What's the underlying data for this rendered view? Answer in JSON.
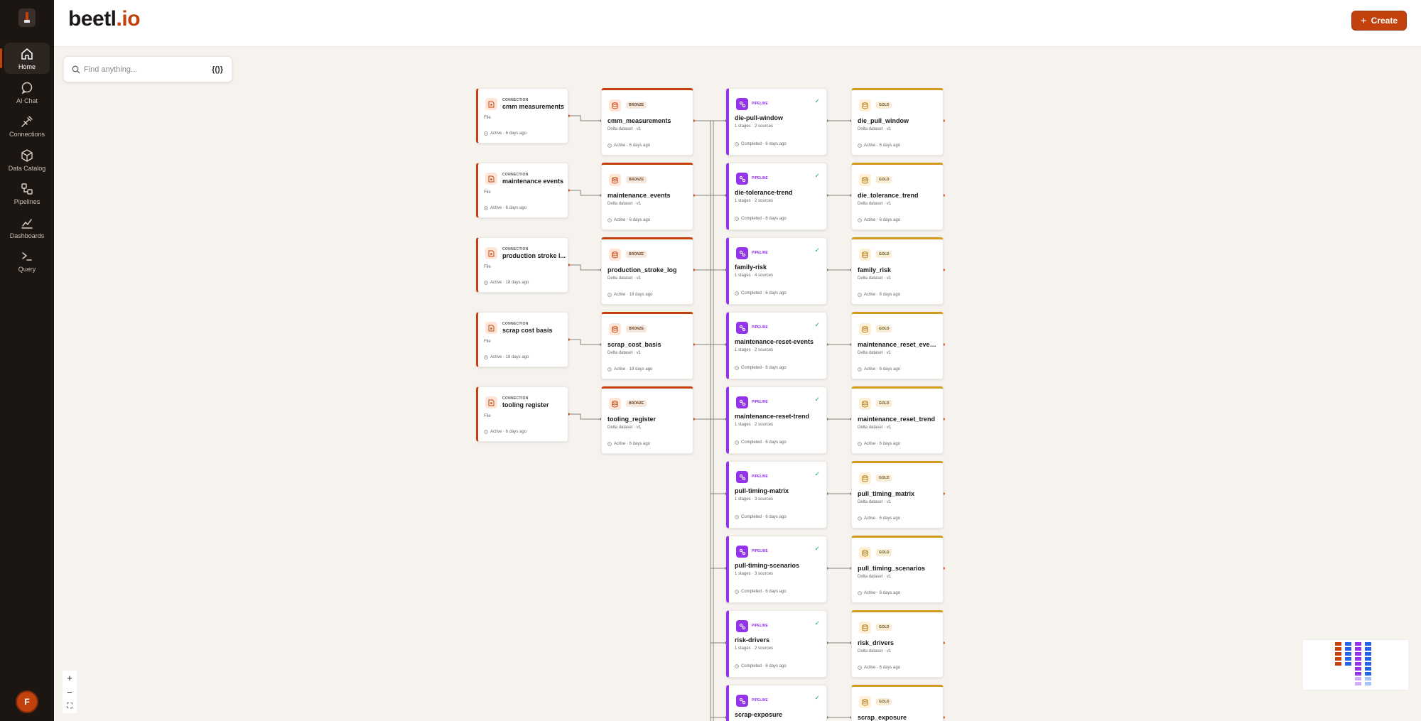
{
  "sidebar": {
    "items": [
      {
        "label": "Home",
        "icon": "home-icon",
        "active": true
      },
      {
        "label": "AI Chat",
        "icon": "chat-icon"
      },
      {
        "label": "Connections",
        "icon": "plug-icon"
      },
      {
        "label": "Data Catalog",
        "icon": "cube-icon"
      },
      {
        "label": "Pipelines",
        "icon": "pipeline-icon"
      },
      {
        "label": "Dashboards",
        "icon": "chart-icon"
      },
      {
        "label": "Query",
        "icon": "terminal-icon"
      }
    ],
    "avatar": "F"
  },
  "header": {
    "brand_main": "beetl",
    "brand_dot": ".io",
    "create_label": "Create"
  },
  "search": {
    "placeholder": "Find anything...",
    "ai_toggle": "{()}"
  },
  "colors": {
    "accent": "#c2410c",
    "pipeline": "#9333ea",
    "gold": "#d39b1e",
    "check": "#16a34a"
  },
  "graph": {
    "connections": [
      {
        "type": "CONNECTION",
        "title": "cmm measurements",
        "sub": "File",
        "status": "Active · 6 days ago"
      },
      {
        "type": "CONNECTION",
        "title": "maintenance events",
        "sub": "File",
        "status": "Active · 6 days ago"
      },
      {
        "type": "CONNECTION",
        "title": "production stroke l...",
        "sub": "File",
        "status": "Active · 18 days ago"
      },
      {
        "type": "CONNECTION",
        "title": "scrap cost basis",
        "sub": "File",
        "status": "Active · 18 days ago"
      },
      {
        "type": "CONNECTION",
        "title": "tooling register",
        "sub": "File",
        "status": "Active · 6 days ago"
      }
    ],
    "bronze": [
      {
        "badge": "BRONZE",
        "title": "cmm_measurements",
        "sub": "Delta dataset · v1",
        "status": "Active · 6 days ago"
      },
      {
        "badge": "BRONZE",
        "title": "maintenance_events",
        "sub": "Delta dataset · v1",
        "status": "Active · 6 days ago"
      },
      {
        "badge": "BRONZE",
        "title": "production_stroke_log",
        "sub": "Delta dataset · v1",
        "status": "Active · 18 days ago"
      },
      {
        "badge": "BRONZE",
        "title": "scrap_cost_basis",
        "sub": "Delta dataset · v1",
        "status": "Active · 18 days ago"
      },
      {
        "badge": "BRONZE",
        "title": "tooling_register",
        "sub": "Delta dataset · v1",
        "status": "Active · 6 days ago"
      }
    ],
    "pipelines": [
      {
        "badge": "PIPELINE",
        "title": "die-pull-window",
        "sub": "1 stages · 2 sources",
        "status": "Completed · 6 days ago"
      },
      {
        "badge": "PIPELINE",
        "title": "die-tolerance-trend",
        "sub": "1 stages · 2 sources",
        "status": "Completed · 6 days ago"
      },
      {
        "badge": "PIPELINE",
        "title": "family-risk",
        "sub": "1 stages · 4 sources",
        "status": "Completed · 6 days ago"
      },
      {
        "badge": "PIPELINE",
        "title": "maintenance-reset-events",
        "sub": "1 stages · 2 sources",
        "status": "Completed · 6 days ago"
      },
      {
        "badge": "PIPELINE",
        "title": "maintenance-reset-trend",
        "sub": "1 stages · 2 sources",
        "status": "Completed · 6 days ago"
      },
      {
        "badge": "PIPELINE",
        "title": "pull-timing-matrix",
        "sub": "1 stages · 3 sources",
        "status": "Completed · 6 days ago"
      },
      {
        "badge": "PIPELINE",
        "title": "pull-timing-scenarios",
        "sub": "1 stages · 3 sources",
        "status": "Completed · 6 days ago"
      },
      {
        "badge": "PIPELINE",
        "title": "risk-drivers",
        "sub": "1 stages · 2 sources",
        "status": "Completed · 6 days ago"
      },
      {
        "badge": "PIPELINE",
        "title": "scrap-exposure",
        "sub": "",
        "status": ""
      }
    ],
    "gold": [
      {
        "badge": "GOLD",
        "title": "die_pull_window",
        "sub": "Delta dataset · v1",
        "status": "Active · 6 days ago"
      },
      {
        "badge": "GOLD",
        "title": "die_tolerance_trend",
        "sub": "Delta dataset · v1",
        "status": "Active · 6 days ago"
      },
      {
        "badge": "GOLD",
        "title": "family_risk",
        "sub": "Delta dataset · v1",
        "status": "Active · 6 days ago"
      },
      {
        "badge": "GOLD",
        "title": "maintenance_reset_events",
        "sub": "Delta dataset · v1",
        "status": "Active · 6 days ago"
      },
      {
        "badge": "GOLD",
        "title": "maintenance_reset_trend",
        "sub": "Delta dataset · v1",
        "status": "Active · 6 days ago"
      },
      {
        "badge": "GOLD",
        "title": "pull_timing_matrix",
        "sub": "Delta dataset · v1",
        "status": "Active · 6 days ago"
      },
      {
        "badge": "GOLD",
        "title": "pull_timing_scenarios",
        "sub": "Delta dataset · v1",
        "status": "Active · 6 days ago"
      },
      {
        "badge": "GOLD",
        "title": "risk_drivers",
        "sub": "Delta dataset · v1",
        "status": "Active · 6 days ago"
      },
      {
        "badge": "GOLD",
        "title": "scrap_exposure",
        "sub": "",
        "status": ""
      }
    ]
  },
  "zoom_controls": {
    "zoom_in": "+",
    "zoom_out": "−",
    "fit": "⛶"
  }
}
